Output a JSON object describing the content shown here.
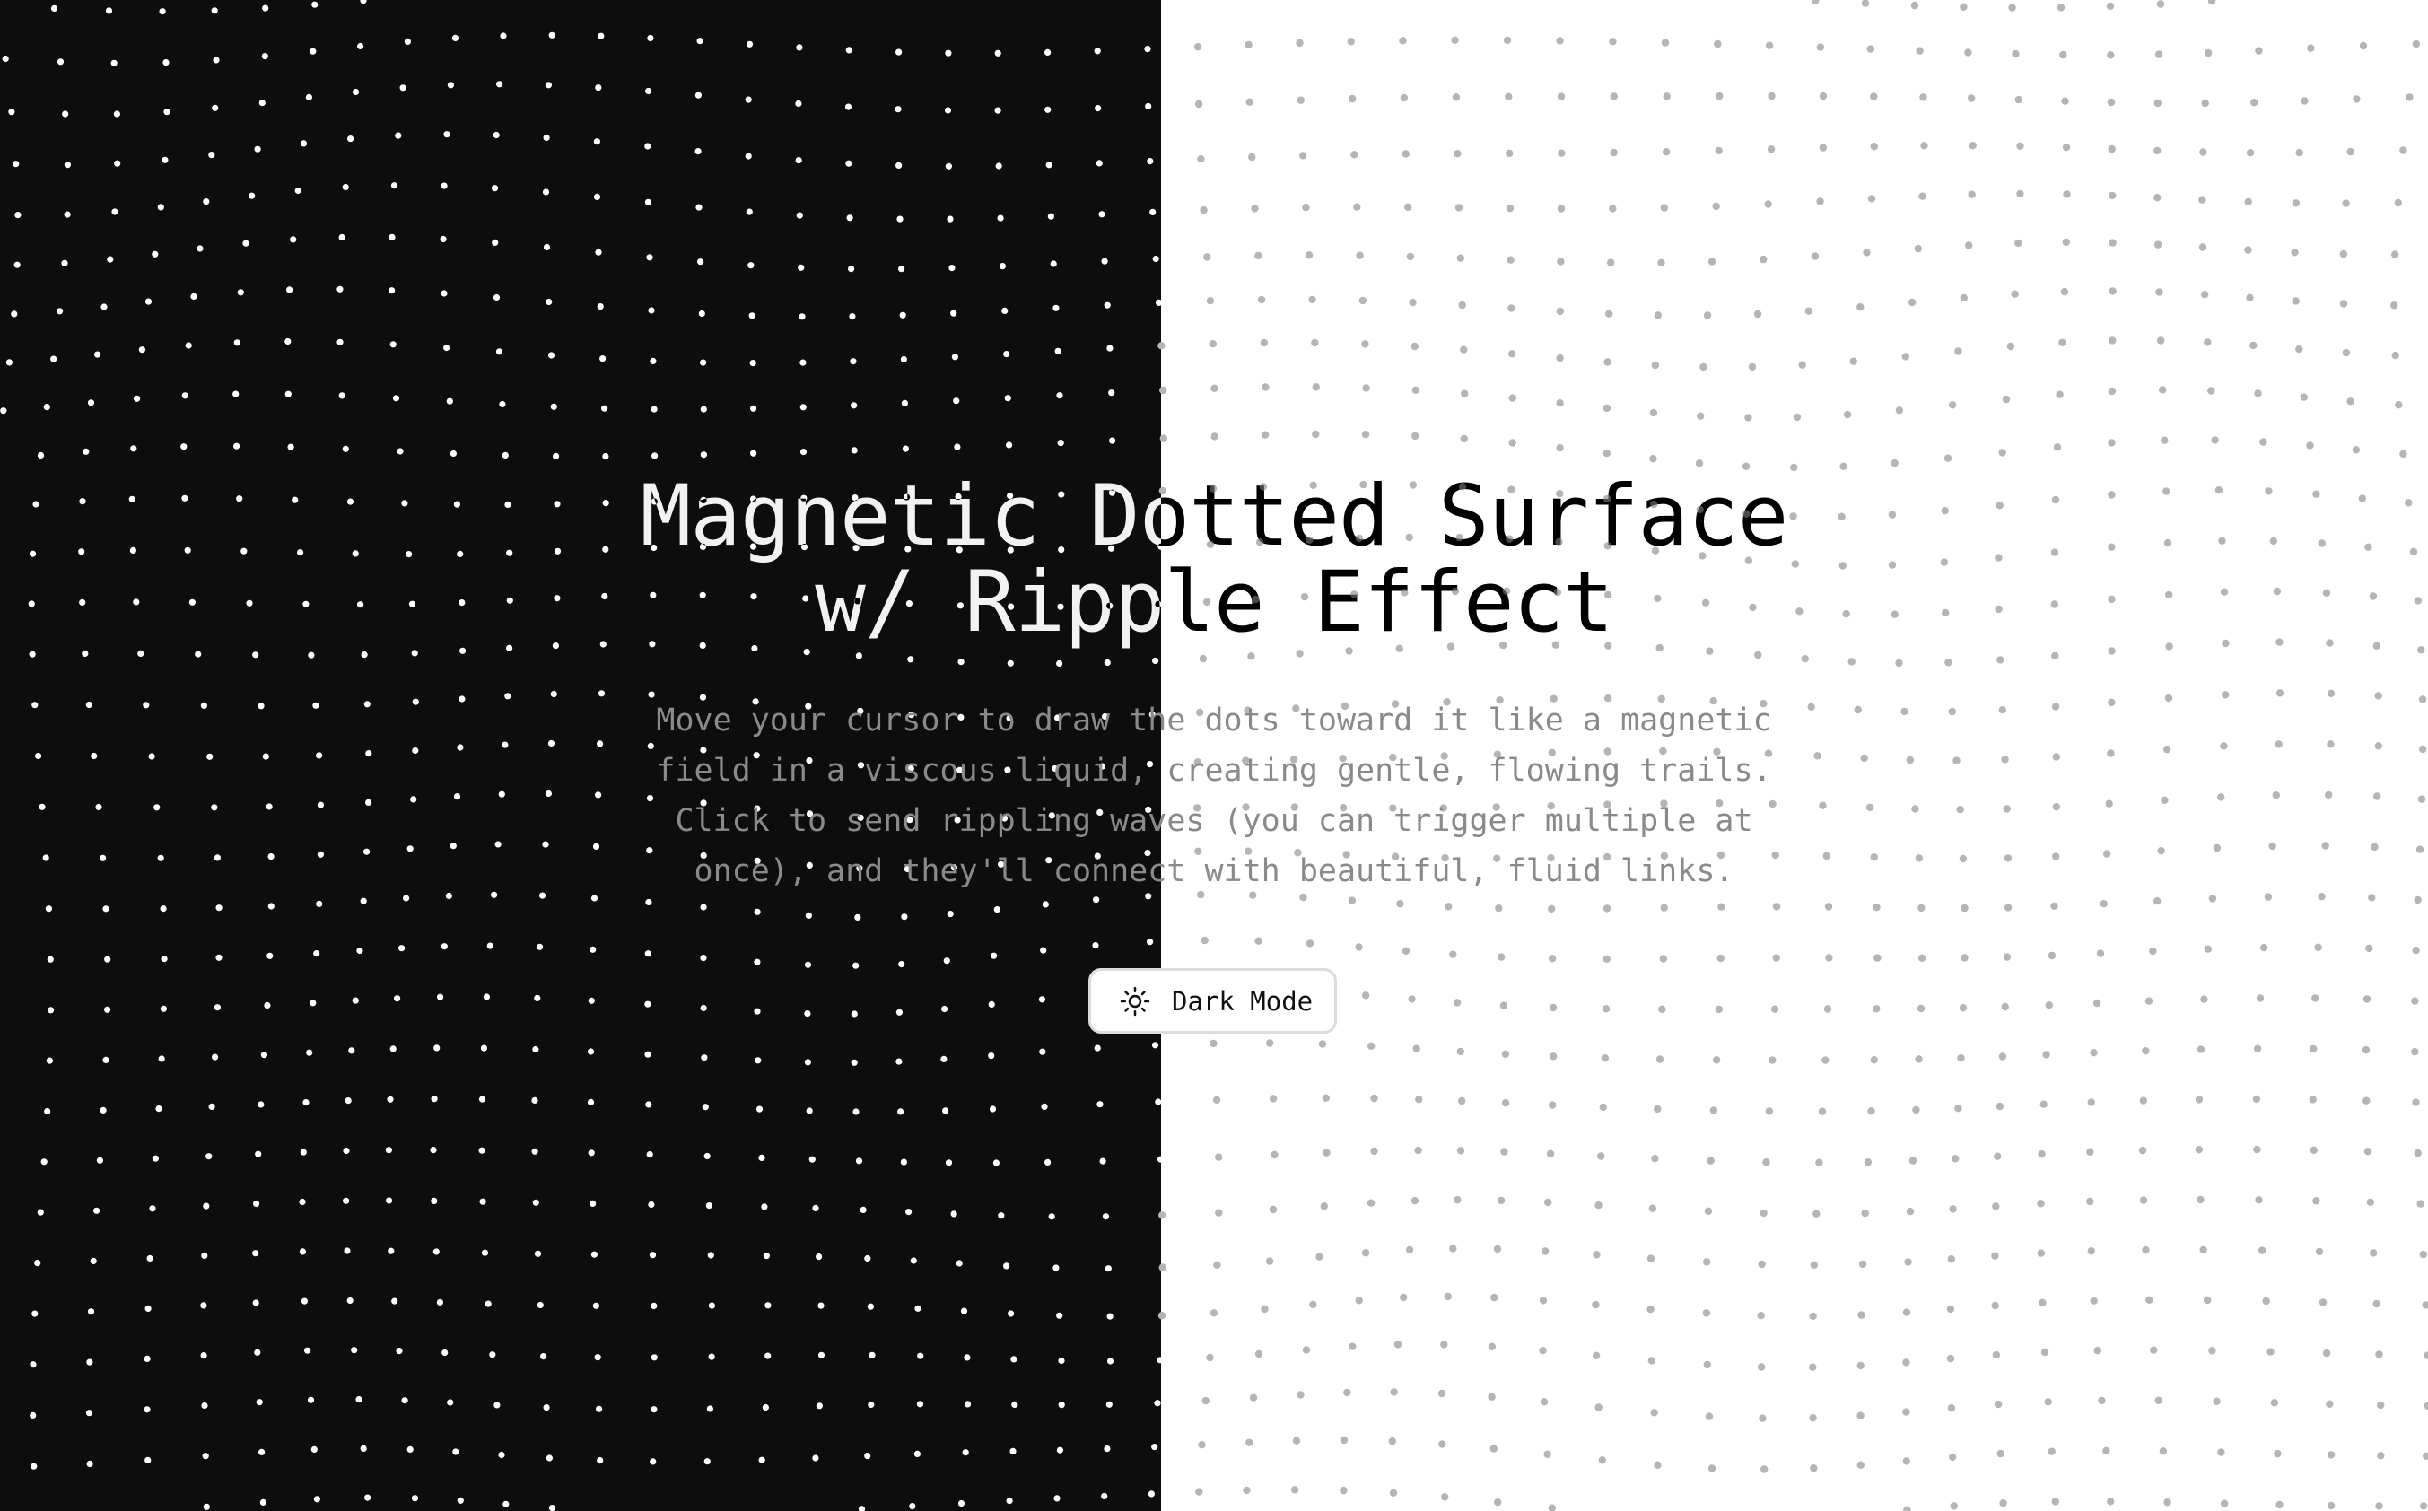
{
  "theme": {
    "dark_background": "#0d0d0d",
    "light_background": "#ffffff",
    "dark_dot_color": "#ffffff",
    "light_dot_color": "#b5b5b5",
    "subtitle_color": "#8a8a8a"
  },
  "hero": {
    "title_lines": [
      "Magnetic Dotted Surface",
      "w/ Ripple Effect"
    ],
    "description_lines": [
      "Move your cursor to draw the dots toward it like a magnetic",
      "field in a viscous liquid, creating gentle, flowing trails.",
      "Click to send rippling waves (you can trigger multiple at",
      "once), and they'll connect with beautiful, fluid links."
    ]
  },
  "toggle": {
    "icon": "sun-icon",
    "label": "Dark Mode"
  }
}
